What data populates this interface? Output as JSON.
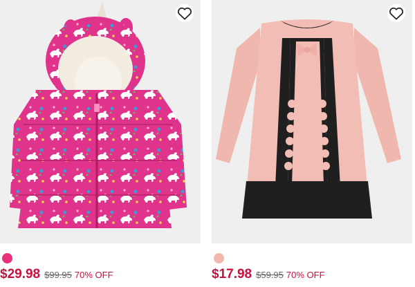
{
  "products": [
    {
      "image_alt": "Toddler Girls Unicorn Print Puffer Jacket",
      "swatch_color": "#e8317a",
      "sale_price": "$29.98",
      "original_price": "$99.95",
      "discount": "70% OFF"
    },
    {
      "image_alt": "Toddler Girls Scalloped Ponte Knit Dress",
      "swatch_color": "#f2b8b0",
      "sale_price": "$17.98",
      "original_price": "$59.95",
      "discount": "70% OFF"
    }
  ],
  "colors": {
    "sale_price": "#c4123e",
    "background": "#efefef"
  },
  "icons": {
    "wishlist": "heart-outline-icon"
  }
}
